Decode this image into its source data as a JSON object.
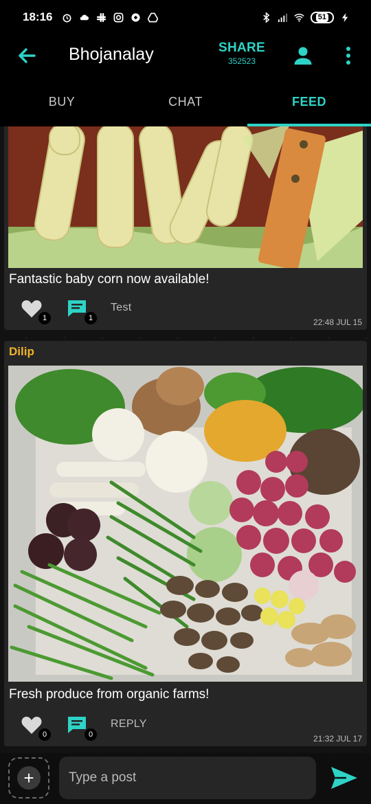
{
  "status_bar": {
    "time": "18:16",
    "battery": "51",
    "icons": [
      "alarm-icon",
      "cloud-icon",
      "slack-icon",
      "instagram-icon",
      "pin-icon",
      "drive-icon",
      "bluetooth-icon",
      "signal-icon",
      "wifi-icon",
      "battery-icon",
      "charging-icon"
    ]
  },
  "app_bar": {
    "title": "Bhojanalay",
    "share_label": "SHARE",
    "share_code": "352523",
    "accent": "#2ed3c6"
  },
  "tabs": [
    {
      "label": "BUY",
      "active": false
    },
    {
      "label": "CHAT",
      "active": false
    },
    {
      "label": "FEED",
      "active": true
    }
  ],
  "posts": [
    {
      "author": "",
      "image": "baby-corn-photo",
      "caption": "Fantastic baby corn now available!",
      "likes": "1",
      "comments": "1",
      "action_label": "Test",
      "timestamp": "22:48 JUL 15"
    },
    {
      "author": "Dilip",
      "image": "vegetables-photo",
      "caption": "Fresh produce from organic farms!",
      "likes": "0",
      "comments": "0",
      "action_label": "REPLY",
      "timestamp": "21:32 JUL 17"
    }
  ],
  "composer": {
    "placeholder": "Type a post"
  },
  "colors": {
    "author_name": "#f0b429",
    "card_bg": "#262626"
  }
}
